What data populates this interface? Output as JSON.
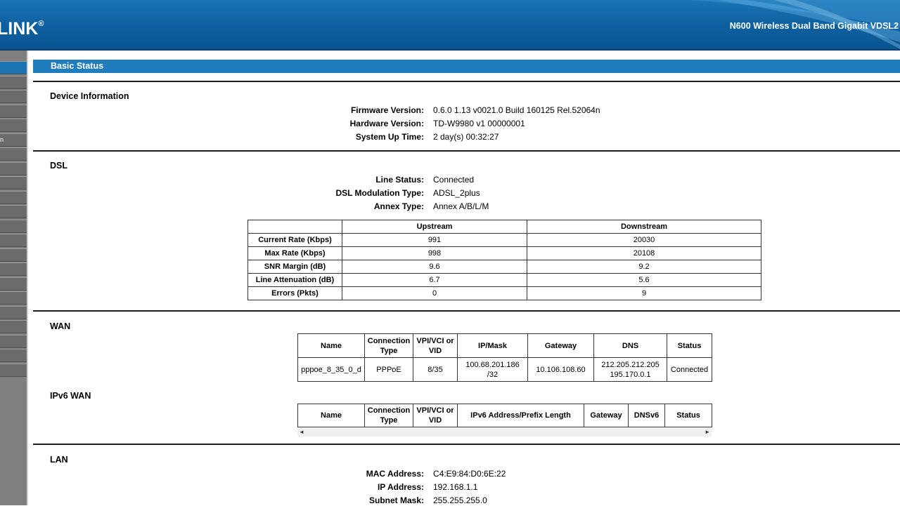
{
  "header": {
    "logo": "LINK",
    "logo_reg": "®",
    "model": "N600 Wireless Dual Band Gigabit VDSL2"
  },
  "sidebar": {
    "partial_label": "n"
  },
  "page": {
    "title": "Basic Status"
  },
  "device_info": {
    "title": "Device Information",
    "rows": [
      {
        "label": "Firmware Version:",
        "value": "0.6.0 1.13 v0021.0 Build 160125 Rel.52064n"
      },
      {
        "label": "Hardware Version:",
        "value": "TD-W9980 v1 00000001"
      },
      {
        "label": "System Up Time:",
        "value": "2 day(s) 00:32:27"
      }
    ]
  },
  "dsl": {
    "title": "DSL",
    "rows": [
      {
        "label": "Line Status:",
        "value": "Connected"
      },
      {
        "label": "DSL Modulation Type:",
        "value": "ADSL_2plus"
      },
      {
        "label": "Annex Type:",
        "value": "Annex A/B/L/M"
      }
    ],
    "table": {
      "headers": [
        "",
        "Upstream",
        "Downstream"
      ],
      "rows": [
        [
          "Current Rate (Kbps)",
          "991",
          "20030"
        ],
        [
          "Max Rate (Kbps)",
          "998",
          "20108"
        ],
        [
          "SNR Margin (dB)",
          "9.6",
          "9.2"
        ],
        [
          "Line Attenuation (dB)",
          "6.7",
          "5.6"
        ],
        [
          "Errors (Pkts)",
          "0",
          "9"
        ]
      ]
    }
  },
  "wan": {
    "title": "WAN",
    "headers": [
      "Name",
      "Connection Type",
      "VPI/VCI or VID",
      "IP/Mask",
      "Gateway",
      "DNS",
      "Status"
    ],
    "row": {
      "name": "pppoe_8_35_0_d",
      "type": "PPPoE",
      "vpi": "8/35",
      "ip_line1": "100.68.201.186",
      "ip_line2": "/32",
      "gateway": "10.106.108.60",
      "dns_line1": "212.205.212.205",
      "dns_line2": "195.170.0.1",
      "status": "Connected"
    }
  },
  "ipv6_wan": {
    "title": "IPv6 WAN",
    "headers": [
      "Name",
      "Connection Type",
      "VPI/VCI or VID",
      "IPv6 Address/Prefix Length",
      "Gateway",
      "DNSv6",
      "Status"
    ],
    "scroll_left": "◄",
    "scroll_right": "►"
  },
  "lan": {
    "title": "LAN",
    "rows": [
      {
        "label": "MAC Address:",
        "value": "C4:E9:84:D0:6E:22"
      },
      {
        "label": "IP Address:",
        "value": "192.168.1.1"
      },
      {
        "label": "Subnet Mask:",
        "value": "255.255.255.0"
      }
    ]
  }
}
